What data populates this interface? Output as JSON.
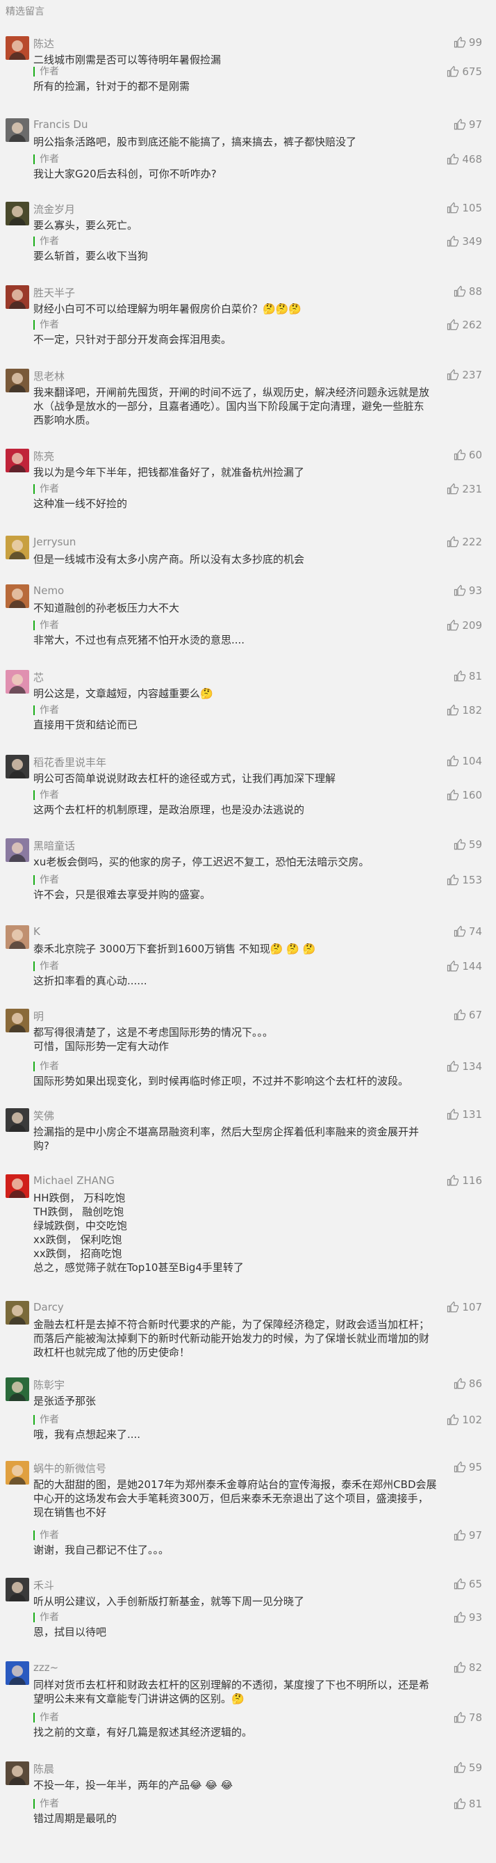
{
  "section_title": "精选留言",
  "author_label": "作者",
  "comments": [
    {
      "name": "陈达",
      "lines": [
        "二线城市刚需是否可以等待明年暑假捡漏"
      ],
      "likes": "99",
      "reply": [
        "所有的捡漏，针对于的都不是刚需"
      ],
      "reply_likes": "675",
      "avatar_color": "#b84a2c"
    },
    {
      "name": "Francis Du",
      "lines": [
        "明公指条活路吧，股市到底还能不能搞了，搞来搞去，裤子都快赔没了"
      ],
      "likes": "97",
      "reply": [
        "我让大家G20后去科创，可你不听咋办?"
      ],
      "reply_likes": "468",
      "avatar_color": "#6b6b6b"
    },
    {
      "name": "流金岁月",
      "lines": [
        "要么寡头，要么死亡。"
      ],
      "likes": "105",
      "reply": [
        "要么斩首，要么收下当狗"
      ],
      "reply_likes": "349",
      "avatar_color": "#4a4a2c"
    },
    {
      "name": "胜天半子",
      "lines": [
        "财经小白可不可以给理解为明年暑假房价白菜价？🤔🤔🤔"
      ],
      "likes": "88",
      "reply": [
        "不一定，只针对于部分开发商会挥泪甩卖。"
      ],
      "reply_likes": "262",
      "avatar_color": "#9a3a2a"
    },
    {
      "name": "思老林",
      "lines": [
        "我来翻译吧，开闸前先囤货，开闸的时间不远了，纵观历史，解决经济问题永远就是放",
        "水（战争是放水的一部分，且嘉者通吃）。国内当下阶段属于定向清理，避免一些脏东",
        "西影响水质。"
      ],
      "likes": "237",
      "reply": [],
      "reply_likes": "",
      "avatar_color": "#7a5a3a"
    },
    {
      "name": "陈亮",
      "lines": [
        "我以为是今年下半年，把钱都准备好了，就准备杭州捡漏了"
      ],
      "likes": "60",
      "reply": [
        "这种准一线不好捡的"
      ],
      "reply_likes": "231",
      "avatar_color": "#c0243a"
    },
    {
      "name": "Jerrysun",
      "lines": [
        "但是一线城市没有太多小房产商。所以没有太多抄底的机会"
      ],
      "likes": "222",
      "reply": [],
      "reply_likes": "",
      "avatar_color": "#c8a040"
    },
    {
      "name": "Nemo",
      "lines": [
        "不知道融创的孙老板压力大不大"
      ],
      "likes": "93",
      "reply": [
        "非常大，不过也有点死猪不怕开水烫的意思...."
      ],
      "reply_likes": "209",
      "avatar_color": "#b86a3a"
    },
    {
      "name": "芯",
      "lines": [
        "明公这是，文章越短，内容越重要么🤔"
      ],
      "likes": "81",
      "reply": [
        "直接用干货和结论而已"
      ],
      "reply_likes": "182",
      "avatar_color": "#e090b0"
    },
    {
      "name": "稻花香里说丰年",
      "lines": [
        "明公可否简单说说财政去杠杆的途径或方式，让我们再加深下理解"
      ],
      "likes": "104",
      "reply": [
        "这两个去杠杆的机制原理，是政治原理，也是没办法逃说的"
      ],
      "reply_likes": "160",
      "avatar_color": "#3a3a3a"
    },
    {
      "name": "黑暗童话",
      "lines": [
        "xu老板会倒吗，买的他家的房子，停工迟迟不复工，恐怕无法暗示交房。"
      ],
      "likes": "59",
      "reply": [
        "许不会，只是很难去享受并购的盛宴。"
      ],
      "reply_likes": "153",
      "avatar_color": "#8a7aa0"
    },
    {
      "name": "K",
      "lines": [
        "泰禾北京院子 3000万下套折到1600万销售  不知现🤔  🤔  🤔"
      ],
      "likes": "74",
      "reply": [
        "这折扣率看的真心动......"
      ],
      "reply_likes": "144",
      "avatar_color": "#c09070"
    },
    {
      "name": "明",
      "lines": [
        "都写得很清楚了，这是不考虑国际形势的情况下。。。",
        "可惜，国际形势一定有大动作"
      ],
      "likes": "67",
      "reply": [
        "国际形势如果出现变化，到时候再临时修正呗，不过并不影响这个去杠杆的波段。"
      ],
      "reply_likes": "134",
      "avatar_color": "#8a6a3a"
    },
    {
      "name": "笑佛",
      "lines": [
        "捡漏指的是中小房企不堪高昂融资利率，然后大型房企挥着低利率融来的资金展开并",
        "购?"
      ],
      "likes": "131",
      "reply": [],
      "reply_likes": "",
      "avatar_color": "#3a3a3a"
    },
    {
      "name": "Michael ZHANG",
      "lines": [
        "HH跌倒，  万科吃饱",
        "TH跌倒，  融创吃饱",
        "绿城跌倒，中交吃饱",
        "xx跌倒，  保利吃饱",
        "xx跌倒，  招商吃饱",
        "总之，感觉筛子就在Top10甚至Big4手里转了"
      ],
      "likes": "116",
      "reply": [],
      "reply_likes": "",
      "avatar_color": "#d0201a"
    },
    {
      "name": "Darcy",
      "lines": [
        "金融去杠杆是去掉不符合新时代要求的产能，为了保障经济稳定，财政会适当加杠杆；",
        "而落后产能被淘汰掉剩下的新时代新动能开始发力的时候，为了保增长就业而增加的财",
        "政杠杆也就完成了他的历史使命！"
      ],
      "likes": "107",
      "reply": [],
      "reply_likes": "",
      "avatar_color": "#7a6a3a"
    },
    {
      "name": "陈彰宇",
      "lines": [
        "是张适予那张"
      ],
      "likes": "86",
      "reply": [
        "哦，我有点想起来了...."
      ],
      "reply_likes": "102",
      "avatar_color": "#2a6a3a"
    },
    {
      "name": "蜗牛的新微信号",
      "lines": [
        "配的大甜甜的图，是她2017年为郑州泰禾金尊府站台的宣传海报，泰禾在郑州CBD会展",
        "中心开的这场发布会大手笔耗资300万，但后来泰禾无奈退出了这个项目，盛澳接手，",
        "现在销售也不好"
      ],
      "likes": "95",
      "reply": [
        "谢谢，我自己都记不住了。。。"
      ],
      "reply_likes": "97",
      "avatar_color": "#e0a040"
    },
    {
      "name": "禾斗",
      "lines": [
        "听从明公建议，入手创新版打新基金，就等下周一见分晓了"
      ],
      "likes": "65",
      "reply": [
        "恩，拭目以待吧"
      ],
      "reply_likes": "93",
      "avatar_color": "#3a3a3a"
    },
    {
      "name": "zzz~",
      "lines": [
        "同样对货币去杠杆和财政去杠杆的区别理解的不透彻，某度搜了下也不明所以，还是希",
        "望明公未来有文章能专门讲讲这俩的区别。🤔"
      ],
      "likes": "82",
      "reply": [
        "找之前的文章，有好几篇是叙述其经济逻辑的。"
      ],
      "reply_likes": "78",
      "avatar_color": "#2a5ac0"
    },
    {
      "name": "陈晨",
      "lines": [
        "不投一年，投一年半，两年的产品😂 😂 😂"
      ],
      "likes": "59",
      "reply": [
        "错过周期是最吼的"
      ],
      "reply_likes": "81",
      "avatar_color": "#5a4a3a"
    }
  ]
}
